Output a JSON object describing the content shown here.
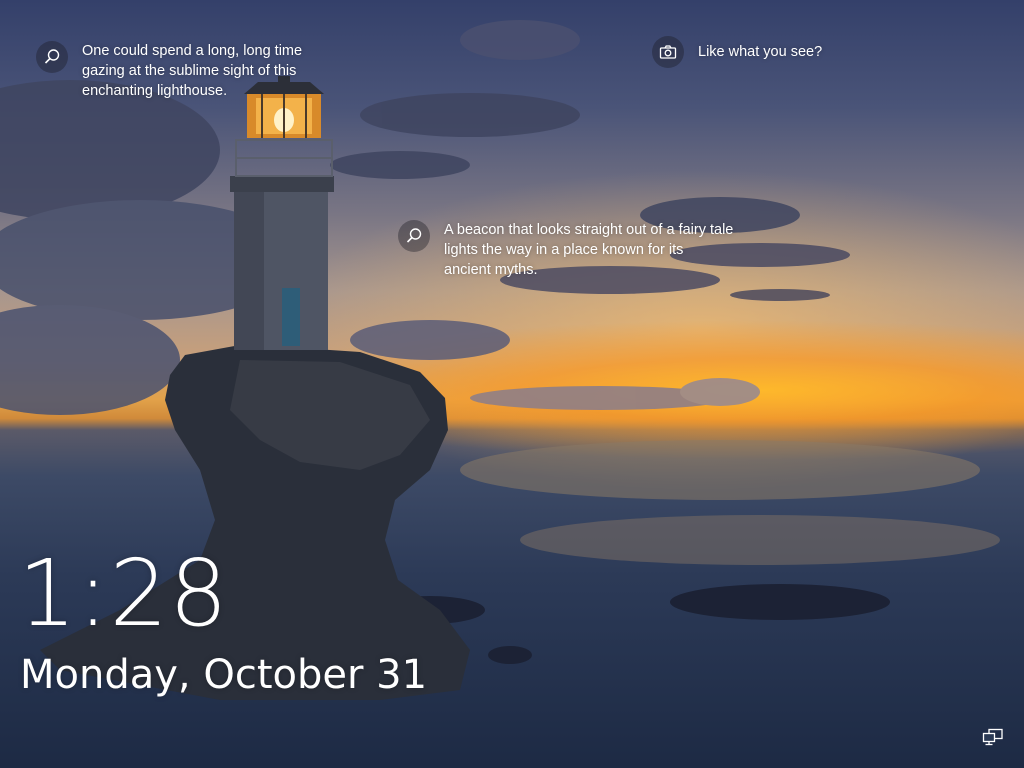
{
  "spotlight": {
    "tip_one": {
      "icon": "search-icon",
      "text": "One could spend a long, long time gazing at the sublime sight of this enchanting lighthouse."
    },
    "like_prompt": {
      "icon": "camera-icon",
      "text": "Like what you see?"
    },
    "tip_two": {
      "icon": "search-icon",
      "text": "A beacon that looks straight out of a fairy tale lights the way in a place known for its ancient myths."
    }
  },
  "clock": {
    "time": "1:28",
    "date": "Monday, October 31"
  },
  "status": {
    "network_icon": "network-monitor-icon"
  },
  "colors": {
    "text": "#ffffff",
    "sunset_glow": "#f0a020",
    "sky_top": "#34406a",
    "sea": "#2c3a57"
  }
}
